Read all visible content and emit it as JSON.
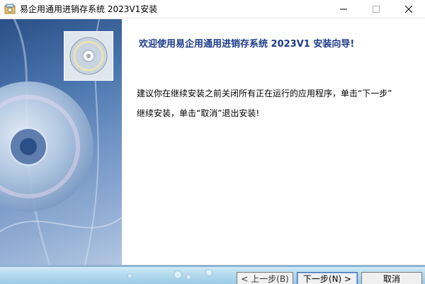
{
  "window": {
    "title": "易企用通用进销存系统 2023V1安装",
    "minimize_icon": "minimize-icon",
    "maximize_icon": "maximize-icon",
    "close_icon": "close-icon"
  },
  "side_panel": {
    "image": "cd-disc-artwork",
    "small_disc_icon": "cd-icon"
  },
  "content": {
    "heading": "欢迎使用易企用通用进销存系统 2023V1 安装向导!",
    "line1": "建议你在继续安装之前关闭所有正在运行的应用程序，单击“下一步”",
    "line2": "继续安装，单击“取消”退出安装!"
  },
  "buttons": {
    "back": "< 上一步(B)",
    "next": "下一步(N) >",
    "cancel": "取消"
  },
  "colors": {
    "heading": "#1c3a8a",
    "side_panel": "#4a74ad",
    "footer": "#b7dcf0"
  }
}
